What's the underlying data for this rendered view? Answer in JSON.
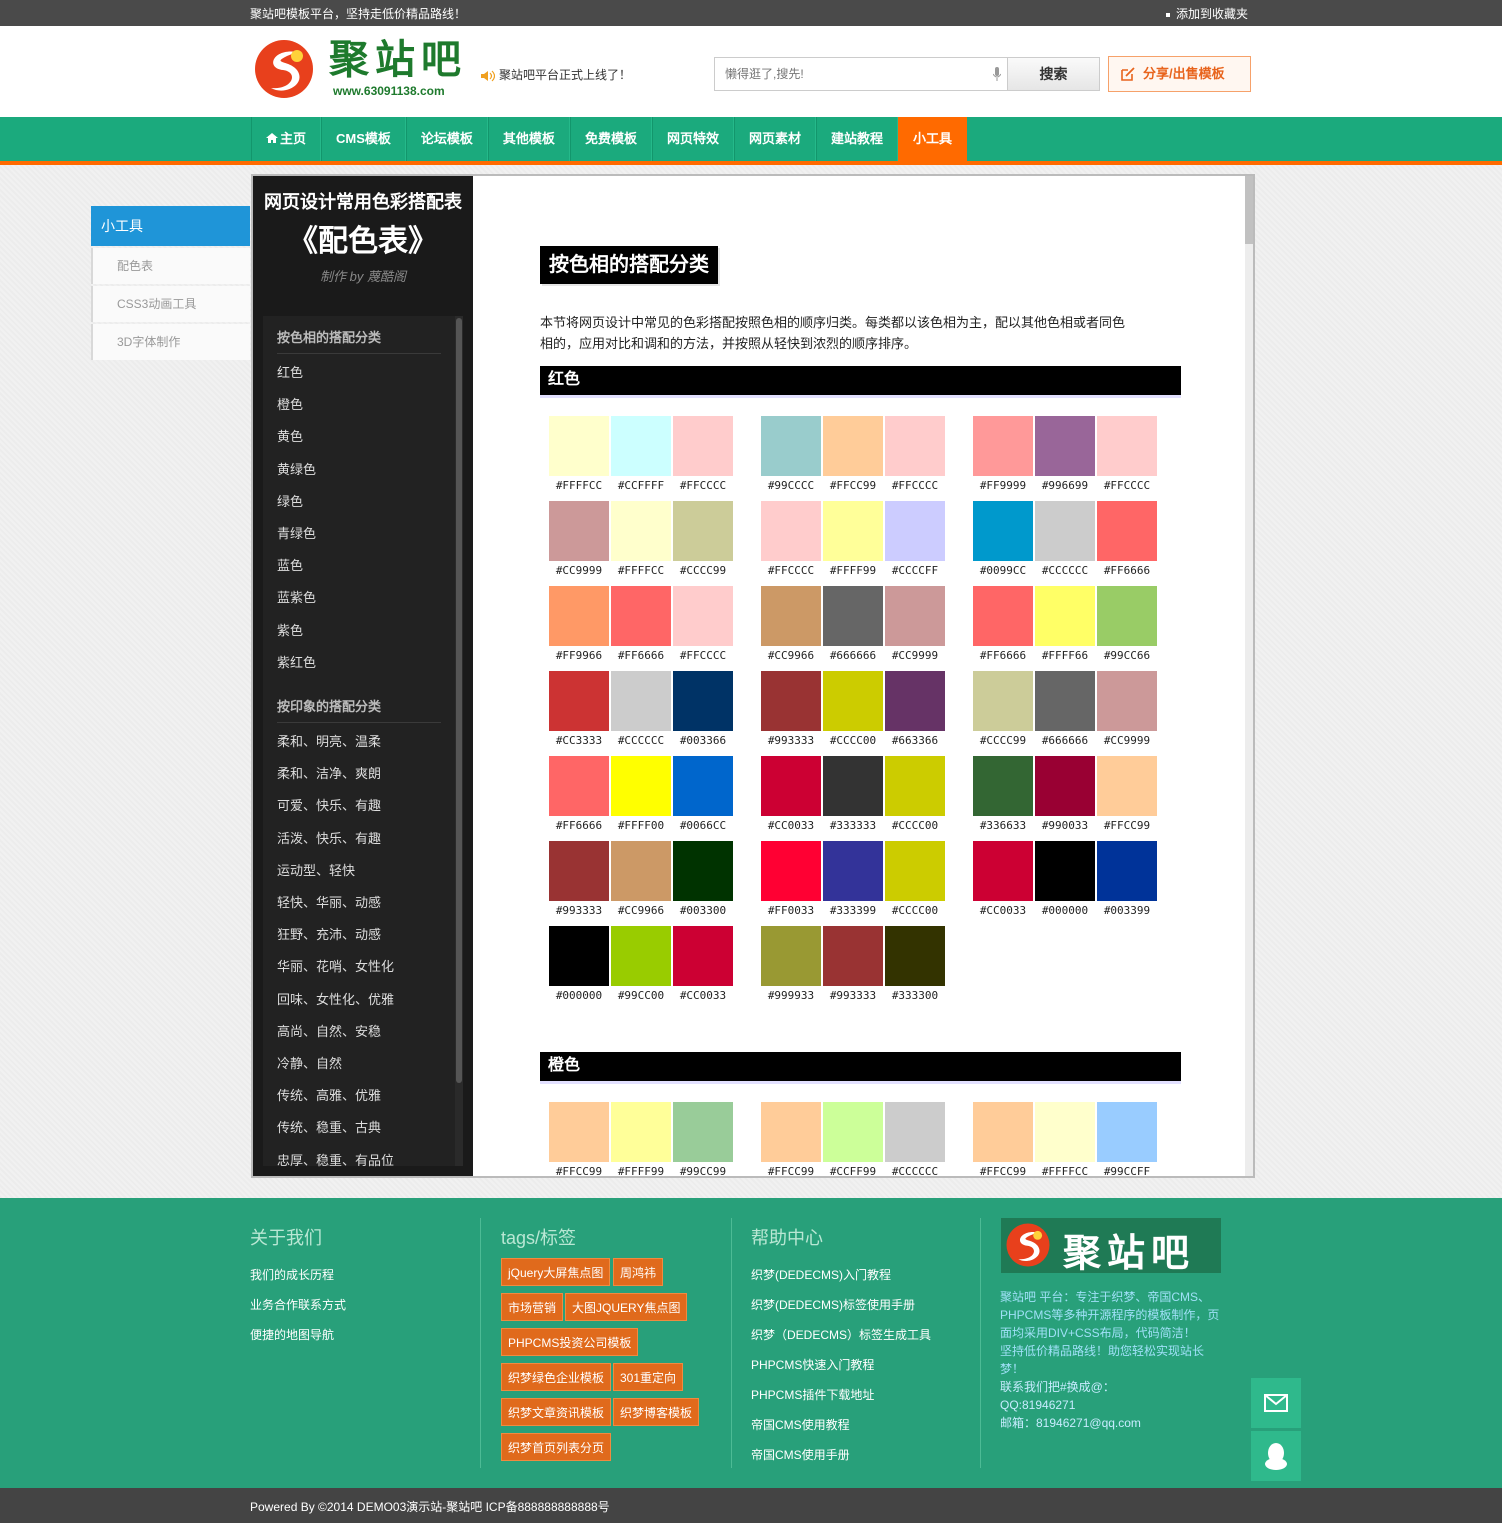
{
  "topbar": {
    "slogan": "聚站吧模板平台，坚持走低价精品路线！",
    "favorite": "添加到收藏夹"
  },
  "header": {
    "logo_name": "聚站吧",
    "logo_url": "www.63091138.com",
    "notice": "聚站吧平台正式上线了！",
    "search_placeholder": "懒得逛了,搜先!",
    "search_button": "搜索",
    "share_button": "分享/出售模板"
  },
  "nav": [
    "主页",
    "CMS模板",
    "论坛模板",
    "其他模板",
    "免费模板",
    "网页特效",
    "网页素材",
    "建站教程",
    "小工具"
  ],
  "sidebar": {
    "title": "小工具",
    "items": [
      "配色表",
      "CSS3动画工具",
      "3D字体制作"
    ]
  },
  "color_table": {
    "title": "网页设计常用色彩搭配表",
    "subtitle": "《配色表》",
    "author": "制作 by 蔑酷阁",
    "menu_sections": [
      {
        "title": "按色相的搭配分类",
        "items": [
          "红色",
          "橙色",
          "黄色",
          "黄绿色",
          "绿色",
          "青绿色",
          "蓝色",
          "蓝紫色",
          "紫色",
          "紫红色"
        ]
      },
      {
        "title": "按印象的搭配分类",
        "items": [
          "柔和、明亮、温柔",
          "柔和、洁净、爽朗",
          "可爱、快乐、有趣",
          "活泼、快乐、有趣",
          "运动型、轻快",
          "轻快、华丽、动感",
          "狂野、充沛、动感",
          "华丽、花哨、女性化",
          "回味、女性化、优雅",
          "高尚、自然、安稳",
          "冷静、自然",
          "传统、高雅、优雅",
          "传统、稳重、古典",
          "忠厚、稳重、有品位"
        ]
      }
    ]
  },
  "content": {
    "heading": "按色相的搭配分类",
    "intro_lines": [
      "本节将网页设计中常见的色彩搭配按照色相的顺序归类。每类都以该色相为主，配以其他色相或者同色",
      "相的，应用对比和调和的方法，并按照从轻快到浓烈的顺序排序。"
    ],
    "categories": [
      {
        "name": "红色",
        "groups": [
          [
            [
              "#FFFFCC",
              "#CCFFFF",
              "#FFCCCC"
            ],
            [
              "#99CCCC",
              "#FFCC99",
              "#FFCCCC"
            ],
            [
              "#FF9999",
              "#996699",
              "#FFCCCC"
            ]
          ],
          [
            [
              "#CC9999",
              "#FFFFCC",
              "#CCCC99"
            ],
            [
              "#FFCCCC",
              "#FFFF99",
              "#CCCCFF"
            ],
            [
              "#0099CC",
              "#CCCCCC",
              "#FF6666"
            ]
          ],
          [
            [
              "#FF9966",
              "#FF6666",
              "#FFCCCC"
            ],
            [
              "#CC9966",
              "#666666",
              "#CC9999"
            ],
            [
              "#FF6666",
              "#FFFF66",
              "#99CC66"
            ]
          ],
          [
            [
              "#CC3333",
              "#CCCCCC",
              "#003366"
            ],
            [
              "#993333",
              "#CCCC00",
              "#663366"
            ],
            [
              "#CCCC99",
              "#666666",
              "#CC9999"
            ]
          ],
          [
            [
              "#FF6666",
              "#FFFF00",
              "#0066CC"
            ],
            [
              "#CC0033",
              "#333333",
              "#CCCC00"
            ],
            [
              "#336633",
              "#990033",
              "#FFCC99"
            ]
          ],
          [
            [
              "#993333",
              "#CC9966",
              "#003300"
            ],
            [
              "#FF0033",
              "#333399",
              "#CCCC00"
            ],
            [
              "#CC0033",
              "#000000",
              "#003399"
            ]
          ],
          [
            [
              "#000000",
              "#99CC00",
              "#CC0033"
            ],
            [
              "#999933",
              "#993333",
              "#333300"
            ]
          ]
        ]
      },
      {
        "name": "橙色",
        "groups": [
          [
            [
              "#FFCC99",
              "#FFFF99",
              "#99CC99"
            ],
            [
              "#FFCC99",
              "#CCFF99",
              "#CCCCCC"
            ],
            [
              "#FFCC99",
              "#FFFFCC",
              "#99CCFF"
            ]
          ]
        ]
      }
    ]
  },
  "footer": {
    "about_title": "关于我们",
    "about_links": [
      "我们的成长历程",
      "业务合作联系方式",
      "便捷的地图导航"
    ],
    "tags_title": "tags/标签",
    "tags": [
      "jQuery大屏焦点图",
      "周鸿祎",
      "市场营销",
      "大图JQUERY焦点图",
      "PHPCMS投资公司模板",
      "织梦绿色企业模板",
      "301重定向",
      "织梦文章资讯模板",
      "织梦博客模板",
      "织梦首页列表分页"
    ],
    "help_title": "帮助中心",
    "help_links": [
      "织梦(DEDECMS)入门教程",
      "织梦(DEDECMS)标签使用手册",
      "织梦（DEDECMS）标签生成工具",
      "PHPCMS快速入门教程",
      "PHPCMS插件下载地址",
      "帝国CMS使用教程",
      "帝国CMS使用手册"
    ],
    "logo_name": "聚站吧",
    "desc_lines": [
      "聚站吧 平台：专注于织梦、帝国CMS、",
      "PHPCMS等多种开源程序的模板制作，页",
      "面均采用DIV+CSS布局，代码简洁！",
      "坚持低价精品路线！助您轻松实现站长",
      "梦！",
      "联系我们把#换成@：",
      "QQ:81946271",
      "邮箱：81946271@qq.com"
    ]
  },
  "bottom": {
    "copyright": "Powered By ©2014 DEMO03演示站-聚站吧 ICP备888888888888号"
  }
}
